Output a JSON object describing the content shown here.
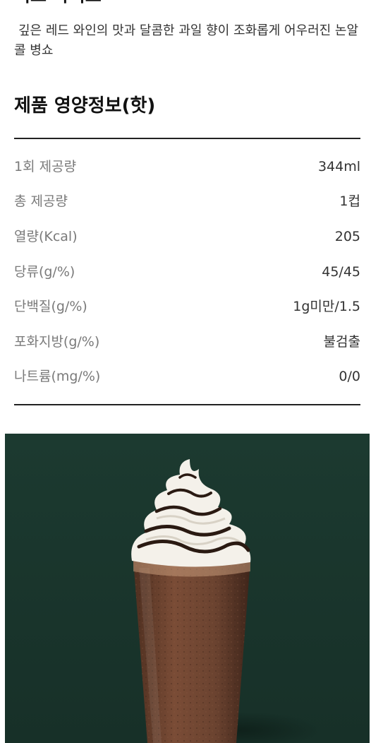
{
  "product": {
    "title": "피크 라이트",
    "description": "깊은 레드 와인의 맛과 달콤한 과일 향이 조화롭게 어우러진 논알콜 병쇼"
  },
  "nutrition": {
    "title": "제품 영양정보(핫)",
    "rows": [
      {
        "label": "1회 제공량",
        "value": "344ml"
      },
      {
        "label": "총 제공량",
        "value": "1컵"
      },
      {
        "label": "열량(Kcal)",
        "value": "205"
      },
      {
        "label": "당류(g/%)",
        "value": "45/45"
      },
      {
        "label": "단백질(g/%)",
        "value": "1g미만/1.5"
      },
      {
        "label": "포화지방(g/%)",
        "value": "불검출"
      },
      {
        "label": "나트륨(mg/%)",
        "value": "0/0"
      }
    ]
  },
  "colors": {
    "photo_background": "#1c3a30",
    "drink": "#6b4330",
    "whipped_cream": "#f4f1ea",
    "chocolate_drizzle": "#2a1a12"
  }
}
